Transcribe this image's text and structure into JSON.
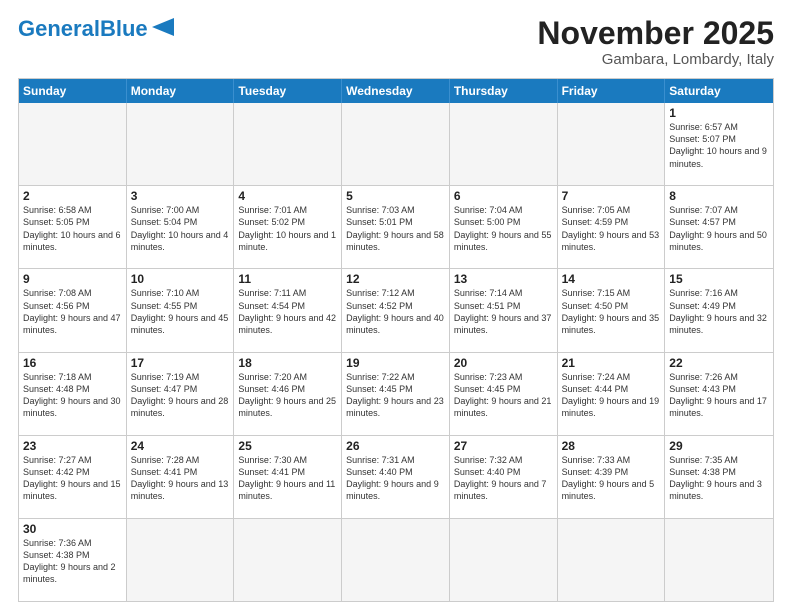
{
  "header": {
    "logo_general": "General",
    "logo_blue": "Blue",
    "month_title": "November 2025",
    "location": "Gambara, Lombardy, Italy"
  },
  "weekdays": [
    "Sunday",
    "Monday",
    "Tuesday",
    "Wednesday",
    "Thursday",
    "Friday",
    "Saturday"
  ],
  "weeks": [
    [
      {
        "day": "",
        "empty": true
      },
      {
        "day": "",
        "empty": true
      },
      {
        "day": "",
        "empty": true
      },
      {
        "day": "",
        "empty": true
      },
      {
        "day": "",
        "empty": true
      },
      {
        "day": "",
        "empty": true
      },
      {
        "day": "1",
        "info": "Sunrise: 6:57 AM\nSunset: 5:07 PM\nDaylight: 10 hours and 9 minutes."
      }
    ],
    [
      {
        "day": "2",
        "info": "Sunrise: 6:58 AM\nSunset: 5:05 PM\nDaylight: 10 hours and 6 minutes."
      },
      {
        "day": "3",
        "info": "Sunrise: 7:00 AM\nSunset: 5:04 PM\nDaylight: 10 hours and 4 minutes."
      },
      {
        "day": "4",
        "info": "Sunrise: 7:01 AM\nSunset: 5:02 PM\nDaylight: 10 hours and 1 minute."
      },
      {
        "day": "5",
        "info": "Sunrise: 7:03 AM\nSunset: 5:01 PM\nDaylight: 9 hours and 58 minutes."
      },
      {
        "day": "6",
        "info": "Sunrise: 7:04 AM\nSunset: 5:00 PM\nDaylight: 9 hours and 55 minutes."
      },
      {
        "day": "7",
        "info": "Sunrise: 7:05 AM\nSunset: 4:59 PM\nDaylight: 9 hours and 53 minutes."
      },
      {
        "day": "8",
        "info": "Sunrise: 7:07 AM\nSunset: 4:57 PM\nDaylight: 9 hours and 50 minutes."
      }
    ],
    [
      {
        "day": "9",
        "info": "Sunrise: 7:08 AM\nSunset: 4:56 PM\nDaylight: 9 hours and 47 minutes."
      },
      {
        "day": "10",
        "info": "Sunrise: 7:10 AM\nSunset: 4:55 PM\nDaylight: 9 hours and 45 minutes."
      },
      {
        "day": "11",
        "info": "Sunrise: 7:11 AM\nSunset: 4:54 PM\nDaylight: 9 hours and 42 minutes."
      },
      {
        "day": "12",
        "info": "Sunrise: 7:12 AM\nSunset: 4:52 PM\nDaylight: 9 hours and 40 minutes."
      },
      {
        "day": "13",
        "info": "Sunrise: 7:14 AM\nSunset: 4:51 PM\nDaylight: 9 hours and 37 minutes."
      },
      {
        "day": "14",
        "info": "Sunrise: 7:15 AM\nSunset: 4:50 PM\nDaylight: 9 hours and 35 minutes."
      },
      {
        "day": "15",
        "info": "Sunrise: 7:16 AM\nSunset: 4:49 PM\nDaylight: 9 hours and 32 minutes."
      }
    ],
    [
      {
        "day": "16",
        "info": "Sunrise: 7:18 AM\nSunset: 4:48 PM\nDaylight: 9 hours and 30 minutes."
      },
      {
        "day": "17",
        "info": "Sunrise: 7:19 AM\nSunset: 4:47 PM\nDaylight: 9 hours and 28 minutes."
      },
      {
        "day": "18",
        "info": "Sunrise: 7:20 AM\nSunset: 4:46 PM\nDaylight: 9 hours and 25 minutes."
      },
      {
        "day": "19",
        "info": "Sunrise: 7:22 AM\nSunset: 4:45 PM\nDaylight: 9 hours and 23 minutes."
      },
      {
        "day": "20",
        "info": "Sunrise: 7:23 AM\nSunset: 4:45 PM\nDaylight: 9 hours and 21 minutes."
      },
      {
        "day": "21",
        "info": "Sunrise: 7:24 AM\nSunset: 4:44 PM\nDaylight: 9 hours and 19 minutes."
      },
      {
        "day": "22",
        "info": "Sunrise: 7:26 AM\nSunset: 4:43 PM\nDaylight: 9 hours and 17 minutes."
      }
    ],
    [
      {
        "day": "23",
        "info": "Sunrise: 7:27 AM\nSunset: 4:42 PM\nDaylight: 9 hours and 15 minutes."
      },
      {
        "day": "24",
        "info": "Sunrise: 7:28 AM\nSunset: 4:41 PM\nDaylight: 9 hours and 13 minutes."
      },
      {
        "day": "25",
        "info": "Sunrise: 7:30 AM\nSunset: 4:41 PM\nDaylight: 9 hours and 11 minutes."
      },
      {
        "day": "26",
        "info": "Sunrise: 7:31 AM\nSunset: 4:40 PM\nDaylight: 9 hours and 9 minutes."
      },
      {
        "day": "27",
        "info": "Sunrise: 7:32 AM\nSunset: 4:40 PM\nDaylight: 9 hours and 7 minutes."
      },
      {
        "day": "28",
        "info": "Sunrise: 7:33 AM\nSunset: 4:39 PM\nDaylight: 9 hours and 5 minutes."
      },
      {
        "day": "29",
        "info": "Sunrise: 7:35 AM\nSunset: 4:38 PM\nDaylight: 9 hours and 3 minutes."
      }
    ],
    [
      {
        "day": "30",
        "info": "Sunrise: 7:36 AM\nSunset: 4:38 PM\nDaylight: 9 hours and 2 minutes."
      },
      {
        "day": "",
        "empty": true
      },
      {
        "day": "",
        "empty": true
      },
      {
        "day": "",
        "empty": true
      },
      {
        "day": "",
        "empty": true
      },
      {
        "day": "",
        "empty": true
      },
      {
        "day": "",
        "empty": true
      }
    ]
  ]
}
